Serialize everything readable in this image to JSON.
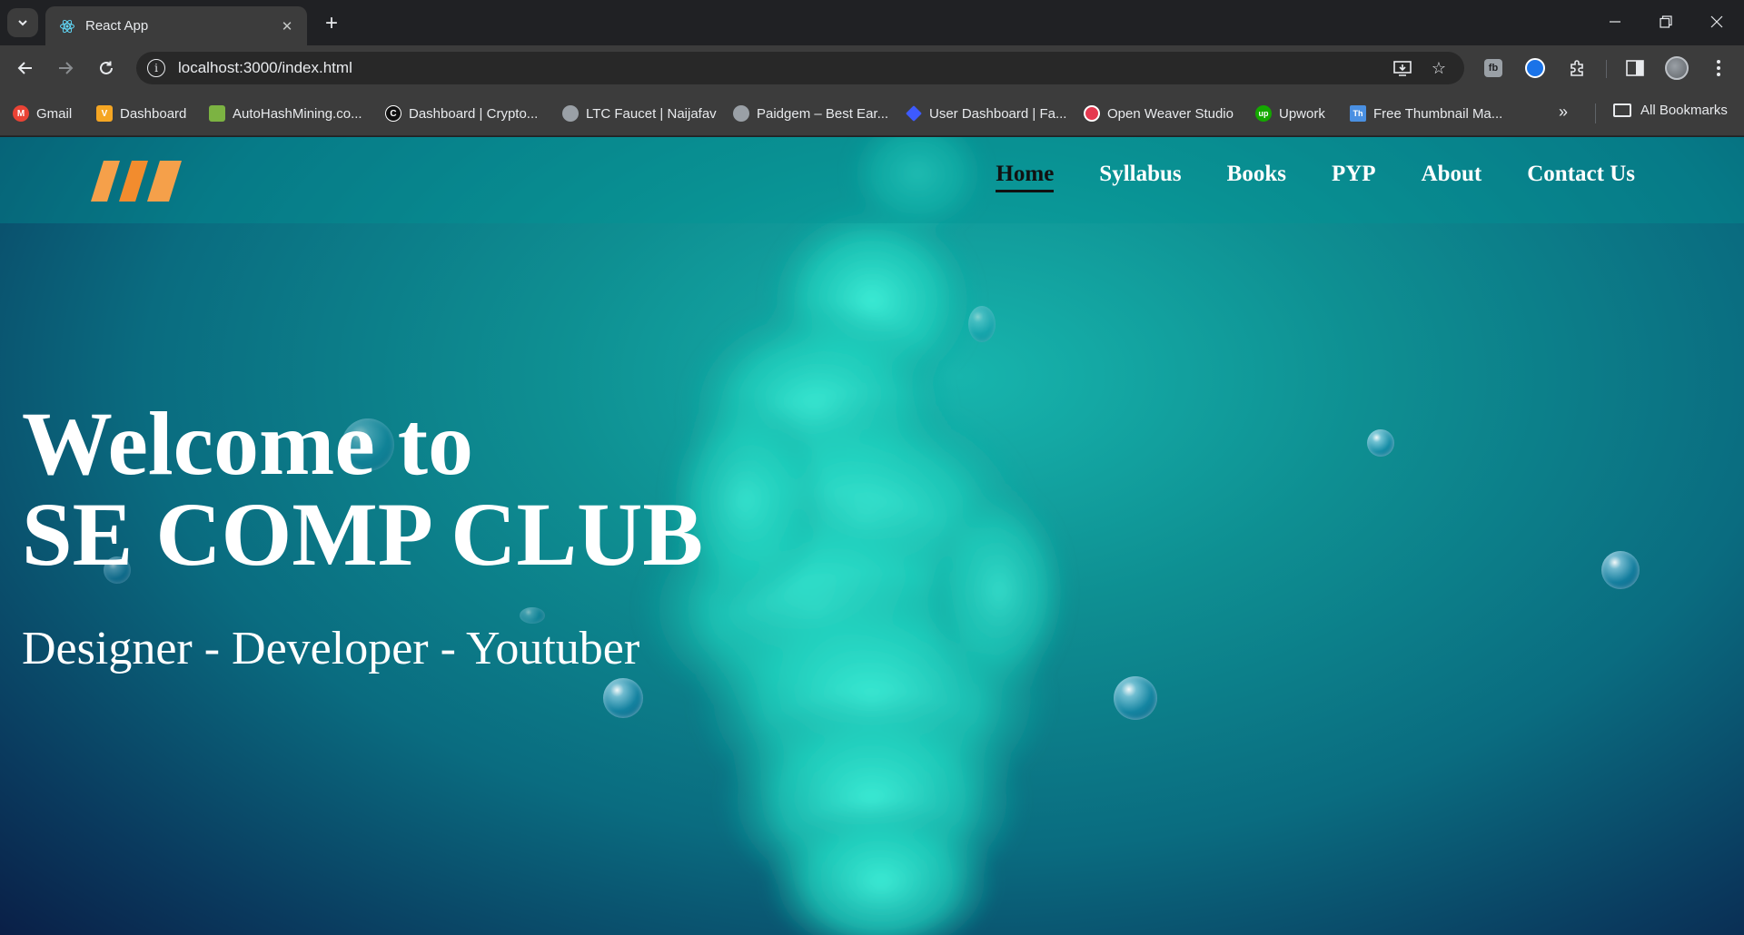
{
  "browser": {
    "tab_title": "React App",
    "url": "localhost:3000/index.html",
    "bookmarks": [
      {
        "label": "Gmail",
        "icon": "gmail-icon",
        "color": "#ea4335",
        "glyph": "M"
      },
      {
        "label": "Dashboard",
        "icon": "v-logo-icon",
        "color": "#f5a623",
        "glyph": "V"
      },
      {
        "label": "AutoHashMining.co...",
        "icon": "cube-icon",
        "color": "#7cb342",
        "glyph": ""
      },
      {
        "label": "Dashboard | Crypto...",
        "icon": "c-logo-icon",
        "color": "#111111",
        "glyph": "C"
      },
      {
        "label": "LTC Faucet | Naijafav",
        "icon": "globe-icon",
        "color": "#9aa0a6",
        "glyph": ""
      },
      {
        "label": "Paidgem – Best Ear...",
        "icon": "globe-icon",
        "color": "#9aa0a6",
        "glyph": ""
      },
      {
        "label": "User Dashboard | Fa...",
        "icon": "diamond-icon",
        "color": "#3d5afe",
        "glyph": ""
      },
      {
        "label": "Open Weaver Studio",
        "icon": "weaver-icon",
        "color": "#e53950",
        "glyph": ""
      },
      {
        "label": "Upwork",
        "icon": "upwork-icon",
        "color": "#14a800",
        "glyph": "up"
      },
      {
        "label": "Free Thumbnail Ma...",
        "icon": "thumbnail-icon",
        "color": "#4a90e2",
        "glyph": "Th"
      }
    ],
    "all_bookmarks_label": "All Bookmarks",
    "extensions": [
      "fb-extension-icon",
      "blue-extension-icon"
    ]
  },
  "site": {
    "nav": [
      {
        "label": "Home",
        "active": true
      },
      {
        "label": "Syllabus",
        "active": false
      },
      {
        "label": "Books",
        "active": false
      },
      {
        "label": "PYP",
        "active": false
      },
      {
        "label": "About",
        "active": false
      },
      {
        "label": "Contact Us",
        "active": false
      }
    ],
    "hero": {
      "line1": "Welcome to",
      "line2": "SE COMP CLUB",
      "subtitle": "Designer - Developer - Youtuber"
    },
    "logo_color": "#f5a04a"
  }
}
